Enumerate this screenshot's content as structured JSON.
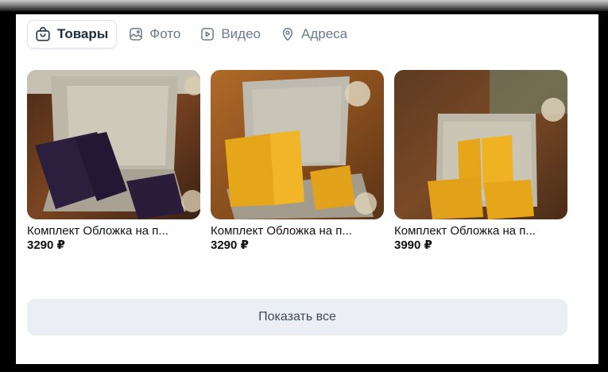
{
  "tabs": [
    {
      "label": "Товары",
      "icon": "shopping-bag-icon",
      "active": true
    },
    {
      "label": "Фото",
      "icon": "image-icon",
      "active": false
    },
    {
      "label": "Видео",
      "icon": "video-icon",
      "active": false
    },
    {
      "label": "Адреса",
      "icon": "map-pin-icon",
      "active": false
    }
  ],
  "products": [
    {
      "name": "Комплект Обложка на п...",
      "price": "3290 ₽",
      "color": "#2c1f3d"
    },
    {
      "name": "Комплект Обложка на п...",
      "price": "3290 ₽",
      "color": "#e6a619"
    },
    {
      "name": "Комплект Обложка на п...",
      "price": "3990 ₽",
      "color": "#e6a619"
    }
  ],
  "show_all_label": "Показать все",
  "colors": {
    "accent_text": "#1f2d3d",
    "muted_text": "#6a7a8c",
    "button_bg": "#ebeff5"
  }
}
